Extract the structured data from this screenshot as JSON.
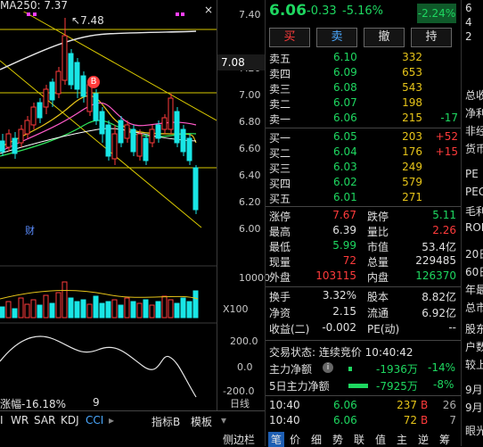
{
  "chart": {
    "ma_label": "MA250: 7.37",
    "peak_label": "7.48",
    "current_price_tag": "7.08",
    "b_marker": "B",
    "news_marker": "财",
    "y_ticks": [
      "7.40",
      "7.20",
      "7.00",
      "6.80",
      "6.60",
      "6.40",
      "6.20",
      "6.00"
    ],
    "volume_tick": "10000",
    "volume_unit": "X100",
    "indicator_ticks": [
      "200.0",
      "0.0",
      "-200.0"
    ],
    "change_label": "涨幅-16.18%",
    "date_label": "9",
    "day_line": "日线",
    "tabs": [
      "I",
      "WR",
      "SAR",
      "KDJ",
      "CCI"
    ],
    "active_tab": "CCI",
    "indicator_btn": "指标B",
    "template_btn": "模板",
    "sidebar_btn": "侧边栏",
    "up_color": "#ff3b3b",
    "down_color": "#19e6e6"
  },
  "quote": {
    "price": "6.06",
    "change": "-0.33",
    "pct": "-5.16%",
    "badge": "-2.24%",
    "buttons": [
      "买",
      "卖",
      "撤",
      "持"
    ]
  },
  "asks": [
    {
      "label": "卖五",
      "price": "6.10",
      "vol": "332",
      "chg": ""
    },
    {
      "label": "卖四",
      "price": "6.09",
      "vol": "653",
      "chg": ""
    },
    {
      "label": "卖三",
      "price": "6.08",
      "vol": "543",
      "chg": ""
    },
    {
      "label": "卖二",
      "price": "6.07",
      "vol": "198",
      "chg": ""
    },
    {
      "label": "卖一",
      "price": "6.06",
      "vol": "215",
      "chg": "-17"
    }
  ],
  "bids": [
    {
      "label": "买一",
      "price": "6.05",
      "vol": "203",
      "chg": "+52"
    },
    {
      "label": "买二",
      "price": "6.04",
      "vol": "176",
      "chg": "+15"
    },
    {
      "label": "买三",
      "price": "6.03",
      "vol": "249",
      "chg": ""
    },
    {
      "label": "买四",
      "price": "6.02",
      "vol": "579",
      "chg": ""
    },
    {
      "label": "买五",
      "price": "6.01",
      "vol": "271",
      "chg": ""
    }
  ],
  "stats": [
    {
      "l1": "涨停",
      "v1": "7.67",
      "c1": "red",
      "l2": "跌停",
      "v2": "5.11",
      "c2": "grn"
    },
    {
      "l1": "最高",
      "v1": "6.39",
      "c1": "wht",
      "l2": "量比",
      "v2": "2.26",
      "c2": "red"
    },
    {
      "l1": "最低",
      "v1": "5.99",
      "c1": "grn",
      "l2": "市值",
      "v2": "53.4亿",
      "c2": "wht"
    },
    {
      "l1": "现量",
      "v1": "72",
      "c1": "red",
      "l2": "总量",
      "v2": "229485",
      "c2": "wht"
    },
    {
      "l1": "外盘",
      "v1": "103115",
      "c1": "red",
      "l2": "内盘",
      "v2": "126370",
      "c2": "grn"
    }
  ],
  "stats2": [
    {
      "l1": "换手",
      "v1": "3.32%",
      "l2": "股本",
      "v2": "8.82亿"
    },
    {
      "l1": "净资",
      "v1": "2.15",
      "l2": "流通",
      "v2": "6.92亿"
    },
    {
      "l1": "收益(二)",
      "v1": "-0.002",
      "l2": "PE(动)",
      "v2": "--"
    }
  ],
  "trade_status": "交易状态: 连续竞价 10:40:42",
  "flows": [
    {
      "label": "主力净额",
      "amount": "-1936万",
      "pct": "-14%"
    },
    {
      "label": "5日主力净额",
      "amount": "-7925万",
      "pct": "-8%"
    }
  ],
  "ticks": [
    {
      "time": "10:40",
      "price": "6.06",
      "vol": "237",
      "side": "B",
      "n": "26"
    },
    {
      "time": "10:40",
      "price": "6.06",
      "vol": "72",
      "side": "B",
      "n": "7"
    }
  ],
  "panel_tabs": [
    "笔",
    "价",
    "细",
    "势",
    "联",
    "值",
    "主",
    "逆",
    "筹"
  ],
  "edge_text": [
    "6",
    "4",
    "2",
    "总收",
    "净利",
    "非经",
    "货币",
    "PE",
    "PEG",
    "毛利",
    "ROE",
    "20日",
    "60日",
    "年最",
    "总市",
    "股东",
    "户数",
    "较上",
    "9月",
    "9月",
    "眼光"
  ]
}
